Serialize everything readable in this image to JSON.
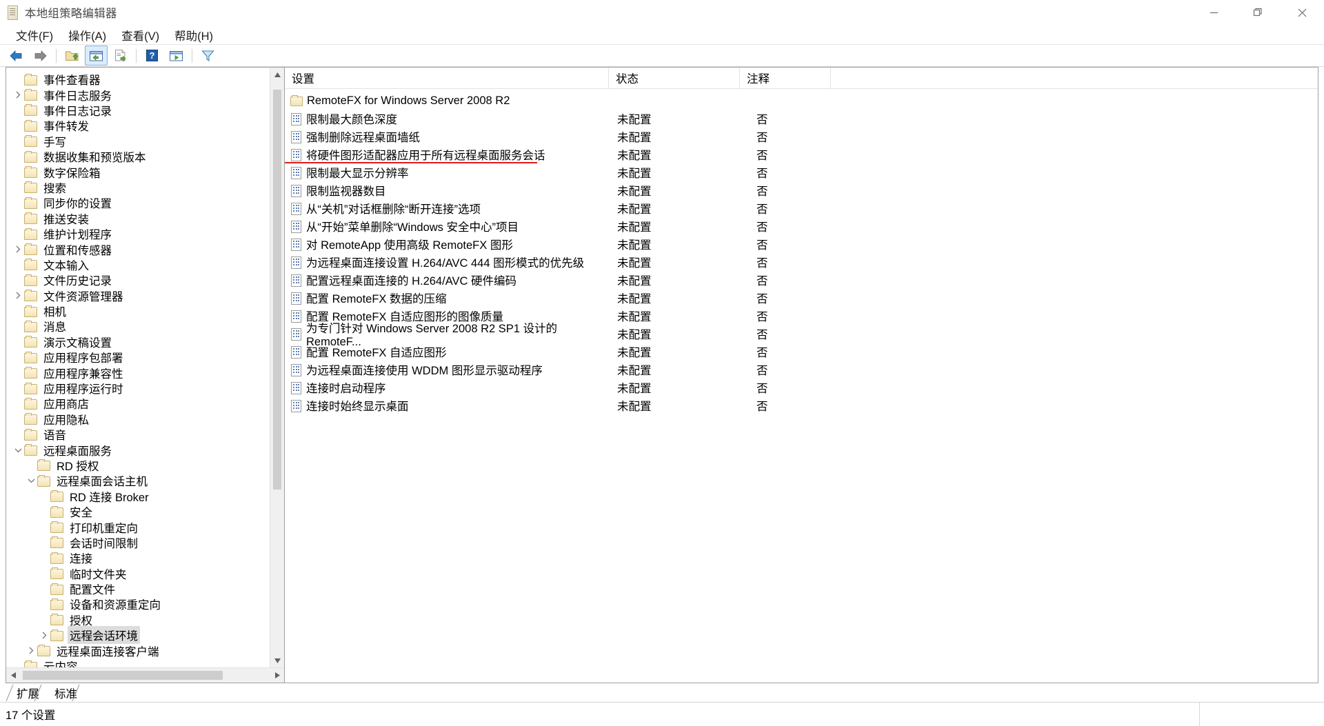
{
  "window": {
    "title": "本地组策略编辑器",
    "app_icon": "policy-editor-icon",
    "controls": {
      "minimize": "minimize-icon",
      "maximize": "maximize-icon",
      "close": "close-icon"
    }
  },
  "menubar": {
    "items": [
      {
        "label": "文件(F)",
        "name": "menu-file"
      },
      {
        "label": "操作(A)",
        "name": "menu-action"
      },
      {
        "label": "查看(V)",
        "name": "menu-view"
      },
      {
        "label": "帮助(H)",
        "name": "menu-help"
      }
    ]
  },
  "toolbar": {
    "buttons": [
      {
        "name": "back-button",
        "icon": "arrow-left-icon"
      },
      {
        "name": "forward-button",
        "icon": "arrow-right-icon"
      },
      {
        "name": "up-one-level-button",
        "icon": "folder-up-icon"
      },
      {
        "name": "show-hide-console-tree-button",
        "icon": "console-tree-icon"
      },
      {
        "name": "export-list-button",
        "icon": "export-list-icon"
      },
      {
        "name": "help-button",
        "icon": "question-mark-icon"
      },
      {
        "name": "properties-button",
        "icon": "properties-icon"
      },
      {
        "name": "filter-button",
        "icon": "funnel-icon"
      }
    ]
  },
  "tree": {
    "nodes": [
      {
        "label": "事件查看器",
        "depth": 3,
        "twist": "",
        "selected": false
      },
      {
        "label": "事件日志服务",
        "depth": 3,
        "twist": "collapsed",
        "selected": false
      },
      {
        "label": "事件日志记录",
        "depth": 3,
        "twist": "",
        "selected": false
      },
      {
        "label": "事件转发",
        "depth": 3,
        "twist": "",
        "selected": false
      },
      {
        "label": "手写",
        "depth": 3,
        "twist": "",
        "selected": false
      },
      {
        "label": "数据收集和预览版本",
        "depth": 3,
        "twist": "",
        "selected": false
      },
      {
        "label": "数字保险箱",
        "depth": 3,
        "twist": "",
        "selected": false
      },
      {
        "label": "搜索",
        "depth": 3,
        "twist": "",
        "selected": false
      },
      {
        "label": "同步你的设置",
        "depth": 3,
        "twist": "",
        "selected": false
      },
      {
        "label": "推送安装",
        "depth": 3,
        "twist": "",
        "selected": false
      },
      {
        "label": "维护计划程序",
        "depth": 3,
        "twist": "",
        "selected": false
      },
      {
        "label": "位置和传感器",
        "depth": 3,
        "twist": "collapsed",
        "selected": false
      },
      {
        "label": "文本输入",
        "depth": 3,
        "twist": "",
        "selected": false
      },
      {
        "label": "文件历史记录",
        "depth": 3,
        "twist": "",
        "selected": false
      },
      {
        "label": "文件资源管理器",
        "depth": 3,
        "twist": "collapsed",
        "selected": false
      },
      {
        "label": "相机",
        "depth": 3,
        "twist": "",
        "selected": false
      },
      {
        "label": "消息",
        "depth": 3,
        "twist": "",
        "selected": false
      },
      {
        "label": "演示文稿设置",
        "depth": 3,
        "twist": "",
        "selected": false
      },
      {
        "label": "应用程序包部署",
        "depth": 3,
        "twist": "",
        "selected": false
      },
      {
        "label": "应用程序兼容性",
        "depth": 3,
        "twist": "",
        "selected": false
      },
      {
        "label": "应用程序运行时",
        "depth": 3,
        "twist": "",
        "selected": false
      },
      {
        "label": "应用商店",
        "depth": 3,
        "twist": "",
        "selected": false
      },
      {
        "label": "应用隐私",
        "depth": 3,
        "twist": "",
        "selected": false
      },
      {
        "label": "语音",
        "depth": 3,
        "twist": "",
        "selected": false
      },
      {
        "label": "远程桌面服务",
        "depth": 3,
        "twist": "expanded",
        "selected": false
      },
      {
        "label": "RD 授权",
        "depth": 4,
        "twist": "",
        "selected": false
      },
      {
        "label": "远程桌面会话主机",
        "depth": 4,
        "twist": "expanded",
        "selected": false
      },
      {
        "label": "RD 连接 Broker",
        "depth": 5,
        "twist": "",
        "selected": false
      },
      {
        "label": "安全",
        "depth": 5,
        "twist": "",
        "selected": false
      },
      {
        "label": "打印机重定向",
        "depth": 5,
        "twist": "",
        "selected": false
      },
      {
        "label": "会话时间限制",
        "depth": 5,
        "twist": "",
        "selected": false
      },
      {
        "label": "连接",
        "depth": 5,
        "twist": "",
        "selected": false
      },
      {
        "label": "临时文件夹",
        "depth": 5,
        "twist": "",
        "selected": false
      },
      {
        "label": "配置文件",
        "depth": 5,
        "twist": "",
        "selected": false
      },
      {
        "label": "设备和资源重定向",
        "depth": 5,
        "twist": "",
        "selected": false
      },
      {
        "label": "授权",
        "depth": 5,
        "twist": "",
        "selected": false
      },
      {
        "label": "远程会话环境",
        "depth": 5,
        "twist": "collapsed",
        "selected": true
      },
      {
        "label": "远程桌面连接客户端",
        "depth": 4,
        "twist": "collapsed",
        "selected": false
      },
      {
        "label": "云内容",
        "depth": 3,
        "twist": "",
        "selected": false
      }
    ]
  },
  "list": {
    "columns": [
      {
        "key": "setting",
        "label": "设置"
      },
      {
        "key": "state",
        "label": "状态"
      },
      {
        "key": "comment",
        "label": "注释"
      }
    ],
    "rows": [
      {
        "icon": "folder-icon",
        "setting": "RemoteFX for Windows Server 2008 R2",
        "state": "",
        "comment": "",
        "underlined": false
      },
      {
        "icon": "policy-icon",
        "setting": "限制最大颜色深度",
        "state": "未配置",
        "comment": "否",
        "underlined": false
      },
      {
        "icon": "policy-icon",
        "setting": "强制删除远程桌面墙纸",
        "state": "未配置",
        "comment": "否",
        "underlined": false
      },
      {
        "icon": "policy-icon",
        "setting": "将硬件图形适配器应用于所有远程桌面服务会话",
        "state": "未配置",
        "comment": "否",
        "underlined": true
      },
      {
        "icon": "policy-icon",
        "setting": "限制最大显示分辨率",
        "state": "未配置",
        "comment": "否",
        "underlined": false
      },
      {
        "icon": "policy-icon",
        "setting": "限制监视器数目",
        "state": "未配置",
        "comment": "否",
        "underlined": false
      },
      {
        "icon": "policy-icon",
        "setting": "从“关机”对话框删除“断开连接”选项",
        "state": "未配置",
        "comment": "否",
        "underlined": false
      },
      {
        "icon": "policy-icon",
        "setting": "从“开始”菜单删除“Windows 安全中心”项目",
        "state": "未配置",
        "comment": "否",
        "underlined": false
      },
      {
        "icon": "policy-icon",
        "setting": "对 RemoteApp 使用高级 RemoteFX 图形",
        "state": "未配置",
        "comment": "否",
        "underlined": false
      },
      {
        "icon": "policy-icon",
        "setting": "为远程桌面连接设置 H.264/AVC 444 图形模式的优先级",
        "state": "未配置",
        "comment": "否",
        "underlined": false
      },
      {
        "icon": "policy-icon",
        "setting": "配置远程桌面连接的 H.264/AVC 硬件编码",
        "state": "未配置",
        "comment": "否",
        "underlined": false
      },
      {
        "icon": "policy-icon",
        "setting": "配置 RemoteFX 数据的压缩",
        "state": "未配置",
        "comment": "否",
        "underlined": false
      },
      {
        "icon": "policy-icon",
        "setting": "配置 RemoteFX 自适应图形的图像质量",
        "state": "未配置",
        "comment": "否",
        "underlined": false
      },
      {
        "icon": "policy-icon",
        "setting": "为专门针对 Windows Server 2008 R2 SP1 设计的 RemoteF...",
        "state": "未配置",
        "comment": "否",
        "underlined": false
      },
      {
        "icon": "policy-icon",
        "setting": "配置 RemoteFX 自适应图形",
        "state": "未配置",
        "comment": "否",
        "underlined": false
      },
      {
        "icon": "policy-icon",
        "setting": "为远程桌面连接使用 WDDM 图形显示驱动程序",
        "state": "未配置",
        "comment": "否",
        "underlined": false
      },
      {
        "icon": "policy-icon",
        "setting": "连接时启动程序",
        "state": "未配置",
        "comment": "否",
        "underlined": false
      },
      {
        "icon": "policy-icon",
        "setting": "连接时始终显示桌面",
        "state": "未配置",
        "comment": "否",
        "underlined": false
      }
    ]
  },
  "tabs": [
    {
      "label": "扩展",
      "name": "tab-extended",
      "active": false
    },
    {
      "label": "标准",
      "name": "tab-standard",
      "active": true
    }
  ],
  "statusbar": {
    "text": "17 个设置"
  },
  "colors": {
    "accent": "#0078d7",
    "highlight_underline": "#e01b1b",
    "selection": "#dcdcdc",
    "folder": "#f3e4b4"
  }
}
